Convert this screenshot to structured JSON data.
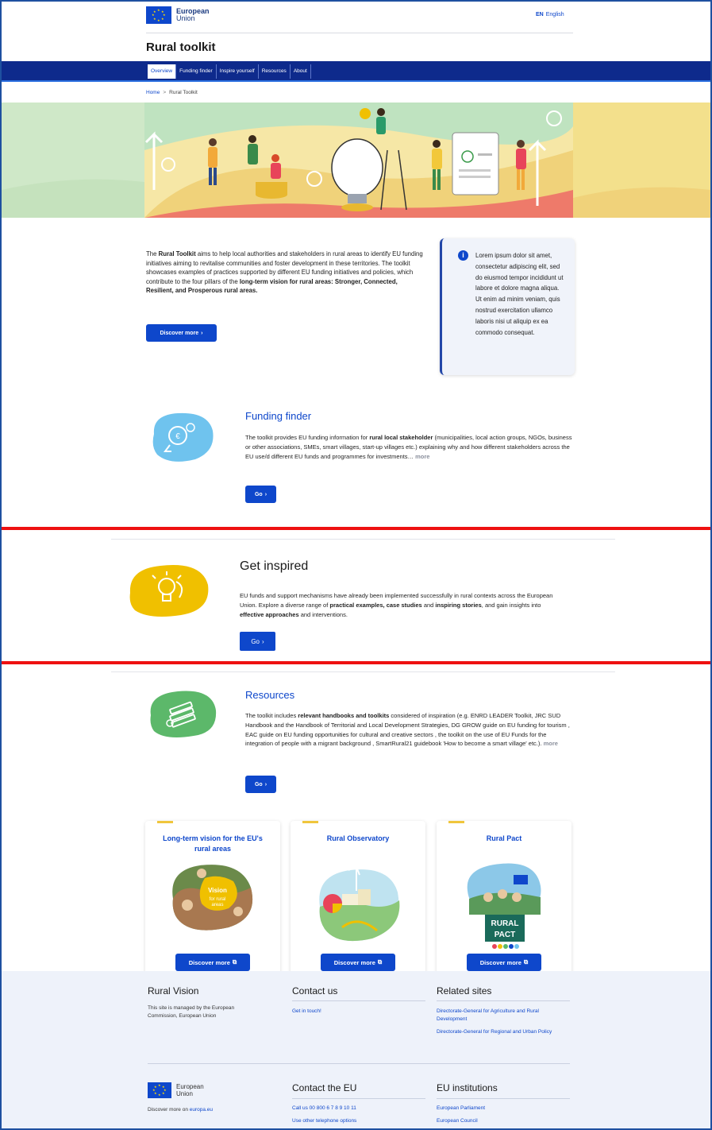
{
  "header": {
    "logo_line1": "European",
    "logo_line2": "Union",
    "lang_code": "EN",
    "lang_name": "English",
    "site_title": "Rural toolkit"
  },
  "nav": {
    "items": [
      {
        "label": "Overview",
        "active": true
      },
      {
        "label": "Funding finder",
        "active": false
      },
      {
        "label": "Inspire yourself",
        "active": false
      },
      {
        "label": "Resources",
        "active": false
      },
      {
        "label": "About",
        "active": false
      }
    ]
  },
  "breadcrumb": {
    "home": "Home",
    "separator": ">",
    "current": "Rural Toolkit"
  },
  "intro": {
    "part1": "The ",
    "bold1": "Rural Toolkit",
    "part2": " aims to help local authorities and stakeholders in rural areas to identify EU funding initiatives aiming to revitalise communities and foster development in these territories. The toolkit showcases examples of practices supported by different EU funding initiatives and policies, which contribute to the four pillars of the ",
    "bold2": "long-term vision for rural areas: Stronger, Connected, Resilient, and Prosperous rural areas.",
    "button": "Discover more"
  },
  "infobox": {
    "text": "Lorem ipsum dolor sit amet, consectetur adipiscing elit, sed do eiusmod tempor incididunt ut labore et dolore magna aliqua. Ut enim ad minim veniam, quis nostrud exercitation ullamco laboris nisi ut aliquip ex ea commodo consequat."
  },
  "funding": {
    "title": "Funding finder",
    "p1": "The toolkit provides EU funding information for ",
    "b1": "rural local stakeholder",
    "p2": " (municipalities, local action groups, NGOs, business or other associations, SMEs, smart villages, start-up villages etc.) explaining why and how different stakeholders across the EU use/d different EU funds and programmes for investments…",
    "more": "more",
    "button": "Go"
  },
  "inspired": {
    "title": "Get inspired",
    "p1": "EU funds and support mechanisms have already been implemented successfully in rural contexts across the European Union. Explore a diverse range of ",
    "b1": "practical examples, case studies",
    "p2": " and ",
    "b2": "inspiring stories",
    "p3": ", and gain insights into ",
    "b3": "effective approaches",
    "p4": " and interventions.",
    "button": "Go"
  },
  "resources": {
    "title": "Resources",
    "p1": "The toolkit includes ",
    "b1": "relevant handbooks and toolkits",
    "p2": " considered of inspiration (e.g. ENRD LEADER Toolkit, JRC SUD Handbook and the Handbook of Territorial and Local Development Strategies, DG GROW guide on EU funding for tourism , EAC guide on EU funding opportunities for cultural and creative sectors , the toolkit on the use of EU Funds for the integration of people with a migrant background , SmartRural21 guidebook 'How to become a smart village'  etc.).",
    "more": "more",
    "button": "Go"
  },
  "cards": [
    {
      "title": "Long-term vision for the EU's rural areas",
      "image_text": "Vision for rural areas",
      "button": "Discover more"
    },
    {
      "title": "Rural Observatory",
      "button": "Discover more"
    },
    {
      "title": "Rural Pact",
      "image_text": "RURAL PACT",
      "button": "Discover more"
    }
  ],
  "footer": {
    "col1": {
      "title": "Rural Vision",
      "text": "This site is managed by the European Commission, European Union"
    },
    "col2": {
      "title": "Contact us",
      "link": "Get in touch!"
    },
    "col3": {
      "title": "Related sites",
      "links": [
        "Directorate-General for Agriculture and Rural Development",
        "Directorate-General for Regional and Urban Policy"
      ]
    },
    "bottom": {
      "logo_line1": "European",
      "logo_line2": "Union",
      "discover_prefix": "Discover more on ",
      "discover_link": "europa.eu",
      "contact_title": "Contact the EU",
      "contact_links": [
        "Call us 00 800 6 7 8 9 10 11",
        "Use other telephone options"
      ],
      "inst_title": "EU institutions",
      "inst_links": [
        "European Parliament",
        "European Council"
      ]
    }
  },
  "colors": {
    "primary": "#0e47cb",
    "menubar": "#0e2a8c",
    "funding_blob": "#6fc3ee",
    "inspired_blob": "#f0c000",
    "resources_blob": "#5cb86a",
    "separator_red": "#ee1111",
    "footer_bg": "#eef2fa"
  }
}
